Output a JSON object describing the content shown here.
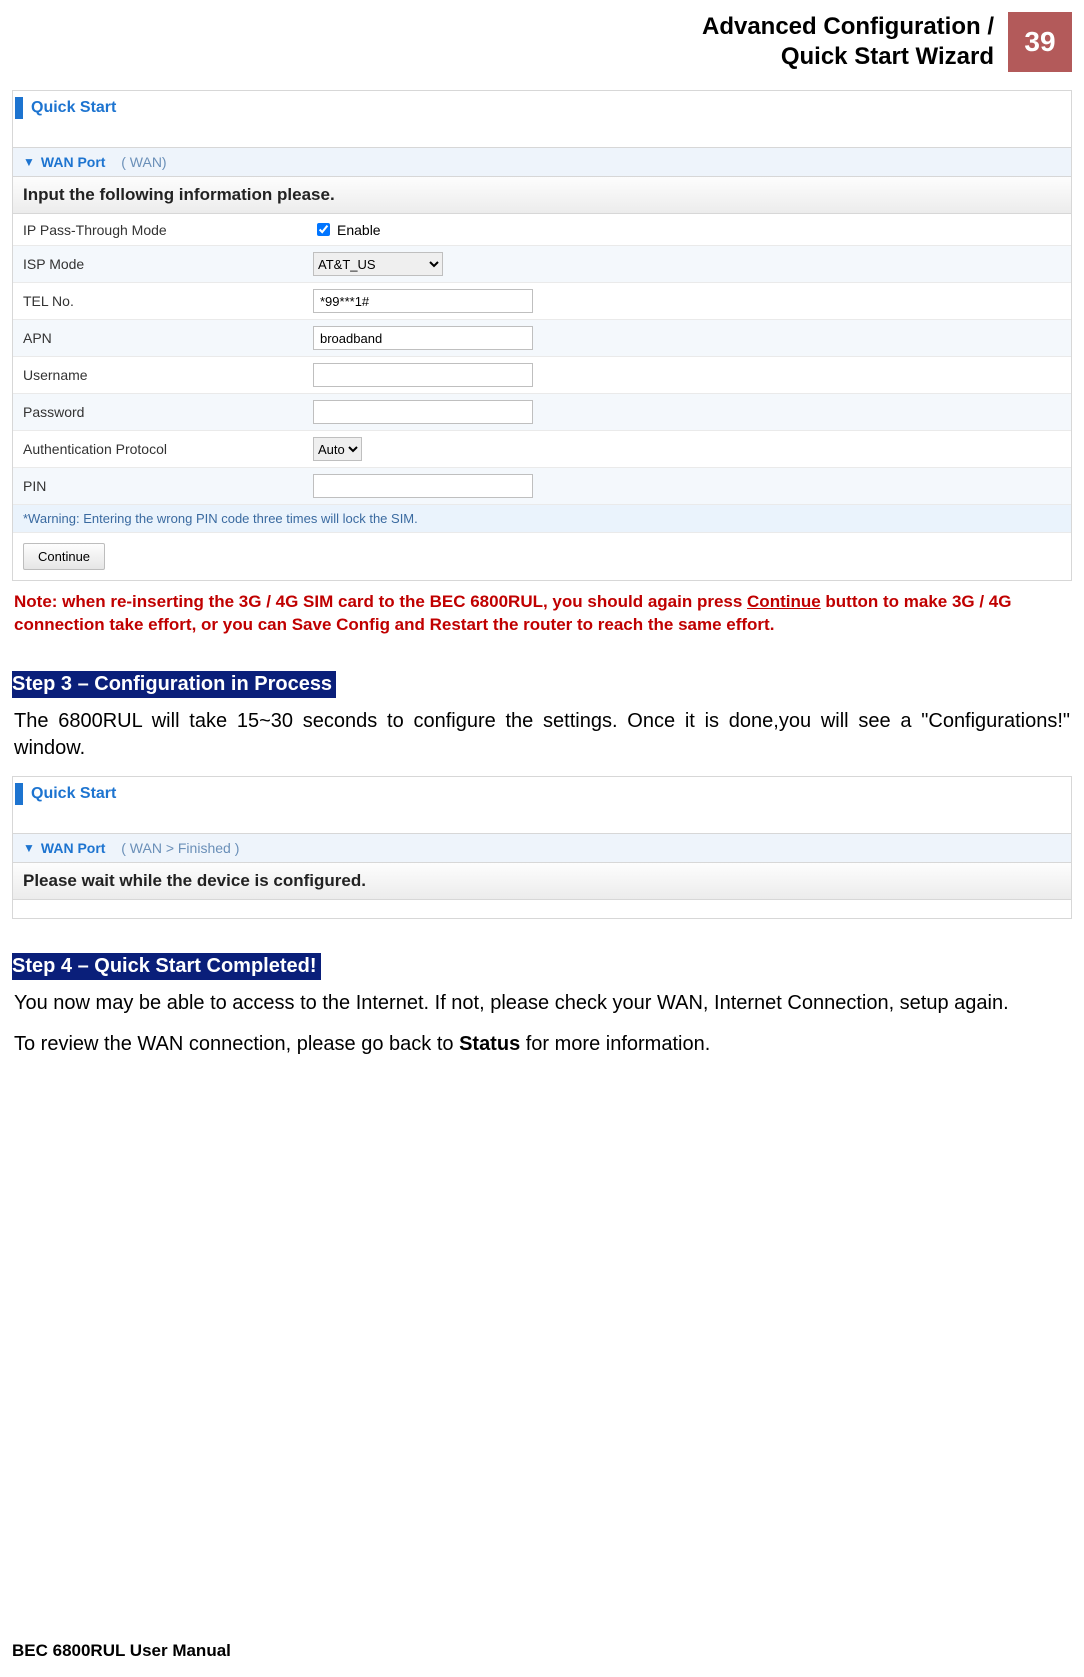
{
  "header": {
    "title_line1": "Advanced Configuration /",
    "title_line2": "Quick Start Wizard",
    "page_number": "39"
  },
  "panel1": {
    "title": "Quick Start",
    "section_label": "WAN Port",
    "section_paren": "( WAN)",
    "instruction": "Input the following information please.",
    "rows": {
      "ip_pass_label": "IP Pass-Through Mode",
      "ip_pass_checkbox_label": "Enable",
      "isp_label": "ISP Mode",
      "isp_value": "AT&T_US",
      "tel_label": "TEL No.",
      "tel_value": "*99***1#",
      "apn_label": "APN",
      "apn_value": "broadband",
      "user_label": "Username",
      "user_value": "",
      "pass_label": "Password",
      "pass_value": "",
      "auth_label": "Authentication Protocol",
      "auth_value": "Auto",
      "pin_label": "PIN",
      "pin_value": ""
    },
    "warning": "*Warning: Entering the wrong PIN code three times will lock the SIM.",
    "continue_btn": "Continue"
  },
  "note_red": {
    "prefix": "Note: when re-inserting the 3G / 4G SIM card to the BEC 6800RUL, you should again press ",
    "underlined": "Continue",
    "suffix": " button to make 3G / 4G connection take effort, or you can Save Config and Restart the router to reach the same effort."
  },
  "step3": {
    "badge": "Step 3 – Configuration in Process",
    "body": "The 6800RUL will take 15~30 seconds to configure the settings. Once it is done,you will see a \"Configurations!\" window."
  },
  "panel2": {
    "title": "Quick Start",
    "section_label": "WAN Port",
    "crumbs": "( WAN  >  Finished )",
    "instruction": "Please wait while the device is configured."
  },
  "step4": {
    "badge": "Step 4 – Quick Start Completed!",
    "body1": "You now may be able to access to the Internet.  If not, please check your WAN, Internet Connection, setup again.",
    "body2_pre": "To review the WAN connection, please go back to ",
    "body2_bold": "Status",
    "body2_post": " for more information."
  },
  "footer": "BEC 6800RUL User Manual"
}
